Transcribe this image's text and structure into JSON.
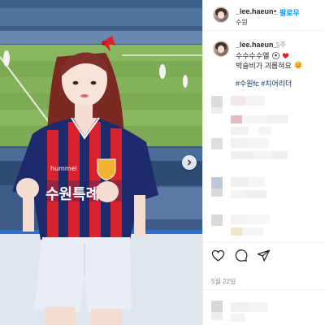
{
  "post": {
    "username": "_lee.haeun_",
    "separator": "•",
    "follow_label": "팔로우",
    "location": "수원"
  },
  "caption": {
    "username": "_lee.haeun_",
    "time_ago": "5주",
    "line1": "수수수수엘",
    "line2": "박슬비가 괴롭혀요",
    "hashtags": [
      "#수원fc",
      "#치어리더"
    ]
  },
  "photo": {
    "jersey_text": "수원특례",
    "jersey_brand": "hummel"
  },
  "actions": {
    "like_icon": "heart-icon",
    "comment_icon": "comment-icon",
    "share_icon": "send-icon"
  },
  "post_date": "5월 22일",
  "colors": {
    "link_blue": "#0095f6",
    "hashtag_blue": "#00376b",
    "jersey_navy": "#1d2a6b",
    "jersey_red": "#d8232f"
  }
}
